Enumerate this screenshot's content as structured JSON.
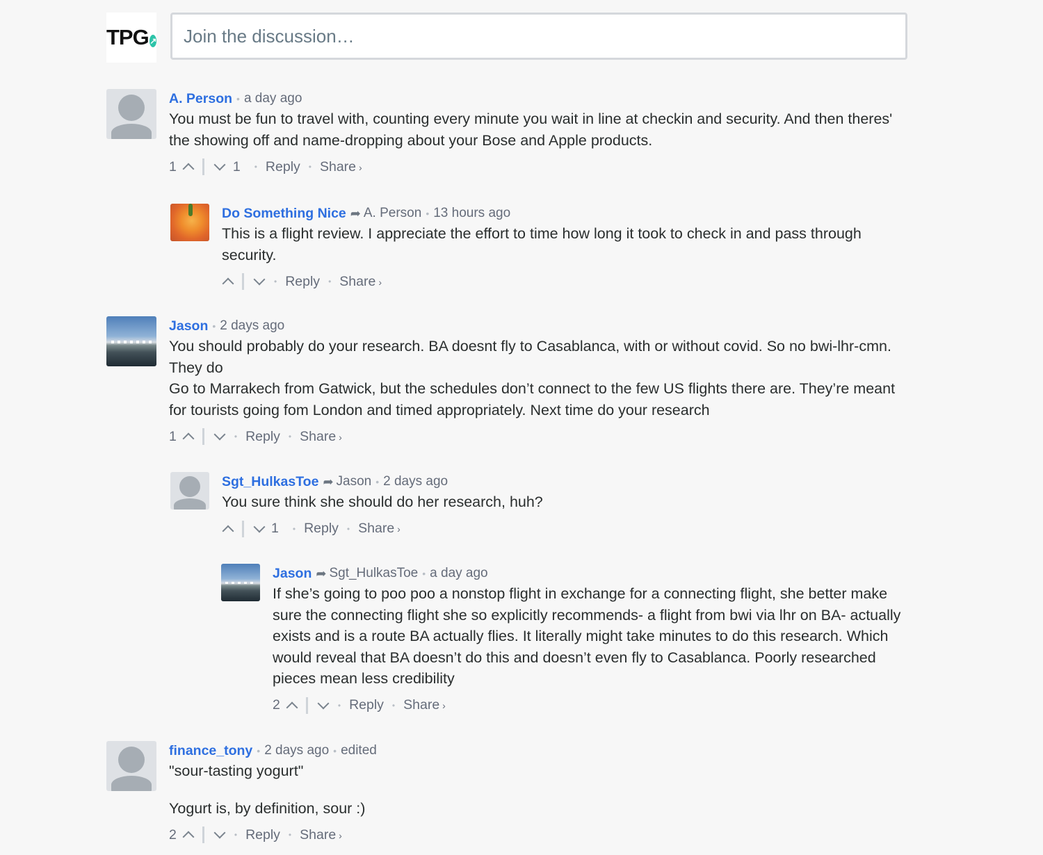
{
  "composer": {
    "logo_text": "TPG",
    "logo_badge": "↗",
    "placeholder": "Join the discussion…"
  },
  "labels": {
    "reply": "Reply",
    "share": "Share",
    "share_arrow": "›"
  },
  "comments": [
    {
      "author": "A. Person",
      "time": "a day ago",
      "lines": [
        "You must be fun to travel with, counting every minute you wait in line at checkin and security. And then theres' the showing off and name-dropping about your Bose and Apple products."
      ],
      "upvotes": "1",
      "downvotes": "1"
    },
    {
      "author": "Do Something Nice",
      "reply_to": "A. Person",
      "time": "13 hours ago",
      "lines": [
        "This is a flight review. I appreciate the effort to time how long it took to check in and pass through security."
      ],
      "upvotes": "",
      "downvotes": ""
    },
    {
      "author": "Jason",
      "time": "2 days ago",
      "lines": [
        "You should probably do your research. BA doesnt fly to Casablanca, with or without covid. So no bwi-lhr-cmn. They do",
        "Go to Marrakech from Gatwick, but the schedules don’t connect to the few US flights there are. They’re meant for tourists going fom London and timed appropriately. Next time do your research"
      ],
      "upvotes": "1",
      "downvotes": ""
    },
    {
      "author": "Sgt_HulkasToe",
      "reply_to": "Jason",
      "time": "2 days ago",
      "lines": [
        "You sure think she should do her research, huh?"
      ],
      "upvotes": "",
      "downvotes": "1"
    },
    {
      "author": "Jason",
      "reply_to": "Sgt_HulkasToe",
      "time": "a day ago",
      "lines": [
        "If she’s going to poo poo a nonstop flight in exchange for a connecting flight, she better make sure the connecting flight she so explicitly recommends- a flight from bwi via lhr on BA- actually exists and is a route BA actually flies. It literally might take minutes to do this research. Which would reveal that BA doesn’t do this and doesn’t even fly to Casablanca. Poorly researched pieces mean less credibility"
      ],
      "upvotes": "2",
      "downvotes": ""
    },
    {
      "author": "finance_tony",
      "time": "2 days ago",
      "edited": "edited",
      "lines": [
        "\"sour-tasting yogurt\"",
        "",
        "Yogurt is, by definition, sour :)"
      ],
      "upvotes": "2",
      "downvotes": ""
    }
  ],
  "icons": {
    "reply_arrow": "share-arrow-icon",
    "upvote": "chevron-up-icon",
    "downvote": "chevron-down-icon"
  }
}
